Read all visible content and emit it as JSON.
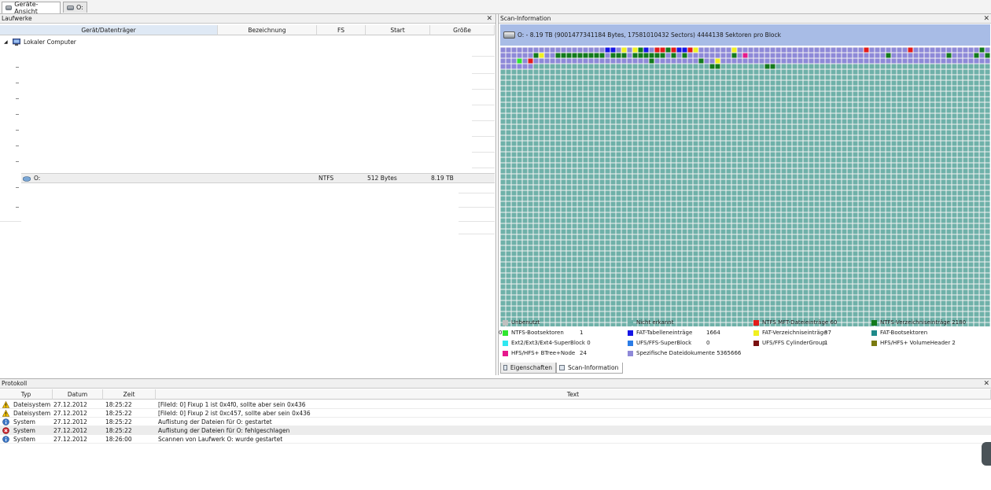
{
  "top_tabs": [
    {
      "label": "Geräte-Ansicht",
      "icon": "devices-icon",
      "active": true
    },
    {
      "label": "O:",
      "icon": "drive-icon",
      "active": false
    }
  ],
  "left_pane": {
    "title": "Laufwerke",
    "columns": [
      "Gerät/Datenträger",
      "Bezeichnung",
      "FS",
      "Start",
      "Größe"
    ],
    "root_label": "Lokaler Computer",
    "drive": {
      "name": "O:",
      "fs": "NTFS",
      "start": "512 Bytes",
      "size": "8.19 TB"
    }
  },
  "right_pane": {
    "title": "Scan-Information",
    "summary": "O: - 8.19 TB (9001477341184 Bytes, 17581010432 Sectors) 4444138 Sektoren pro Block",
    "legend": [
      {
        "label": "Unbenutzt",
        "count": "",
        "color": "#c0c0c0"
      },
      {
        "label": "Nicht erkannt",
        "count": "",
        "color": "#6fb1a9"
      },
      {
        "label": "NTFS MFT-Dateieinträge 60",
        "count": "",
        "color": "#e41a1a"
      },
      {
        "label": "NTFS-Verzeichniseinträge 2180",
        "count": "",
        "color": "#127a1c"
      },
      {
        "label": "NTFS-Bootsektoren",
        "count": "1",
        "color": "#2ee62e"
      },
      {
        "label": "FAT-Tabelleneinträge",
        "count": "1664",
        "color": "#1515e6"
      },
      {
        "label": "FAT-Verzeichniseinträge",
        "count": "37",
        "color": "#f0f020"
      },
      {
        "label": "FAT-Bootsektoren",
        "count": "0",
        "color": "#1f8a8a"
      },
      {
        "label": "Ext2/Ext3/Ext4-SuperBlock 0",
        "count": "",
        "color": "#2fe8f0"
      },
      {
        "label": "UFS/FFS-SuperBlock",
        "count": "0",
        "color": "#2b7ce6"
      },
      {
        "label": "UFS/FFS CylinderGroup",
        "count": "1",
        "color": "#7a1010"
      },
      {
        "label": "HFS/HFS+ VolumeHeader 2",
        "count": "",
        "color": "#7a7a10"
      },
      {
        "label": "HFS/HFS+ BTree+Node",
        "count": "24",
        "color": "#e6188c"
      },
      {
        "label": "Spezifische Dateidokumente 5365666",
        "count": "",
        "color": "#8e89d8"
      }
    ],
    "tabs": [
      {
        "label": "Eigenschaften",
        "active": false
      },
      {
        "label": "Scan-Information",
        "active": true
      }
    ]
  },
  "log_pane": {
    "title": "Protokoll",
    "columns": [
      "Typ",
      "Datum",
      "Zeit",
      "Text"
    ],
    "rows": [
      {
        "type": "Dateisystem",
        "icon": "warning-icon",
        "date": "27.12.2012",
        "time": "18:25:22",
        "text": "[FileId: 0] Fixup 1 ist 0x4f0, sollte aber sein 0x436"
      },
      {
        "type": "Dateisystem",
        "icon": "warning-icon",
        "date": "27.12.2012",
        "time": "18:25:22",
        "text": "[FileId: 0] Fixup 2 ist 0xc457, sollte aber sein 0x436"
      },
      {
        "type": "System",
        "icon": "info-icon",
        "date": "27.12.2012",
        "time": "18:25:22",
        "text": "Auflistung der Dateien für O: gestartet"
      },
      {
        "type": "System",
        "icon": "error-icon",
        "date": "27.12.2012",
        "time": "18:25:22",
        "text": "Auflistung der Dateien für O: fehlgeschlagen"
      },
      {
        "type": "System",
        "icon": "info-icon",
        "date": "27.12.2012",
        "time": "18:26:00",
        "text": "Scannen von Laufwerk O: wurde gestartet"
      }
    ]
  }
}
